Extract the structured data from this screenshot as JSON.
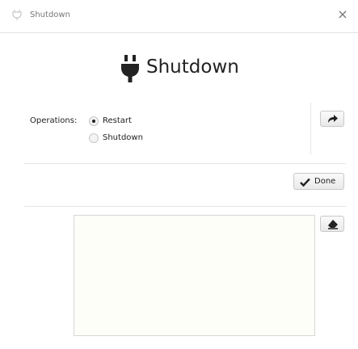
{
  "window": {
    "title": "Shutdown",
    "close_glyph": "×"
  },
  "header": {
    "title": "Shutdown",
    "icon": "plug-icon"
  },
  "operations": {
    "label": "Operations:",
    "options": [
      {
        "label": "Restart",
        "selected": true
      },
      {
        "label": "Shutdown",
        "selected": false
      }
    ]
  },
  "buttons": {
    "run_icon": "share-arrow-icon",
    "done_label": "Done",
    "clear_icon": "eraser-icon"
  },
  "output": {
    "text": ""
  }
}
